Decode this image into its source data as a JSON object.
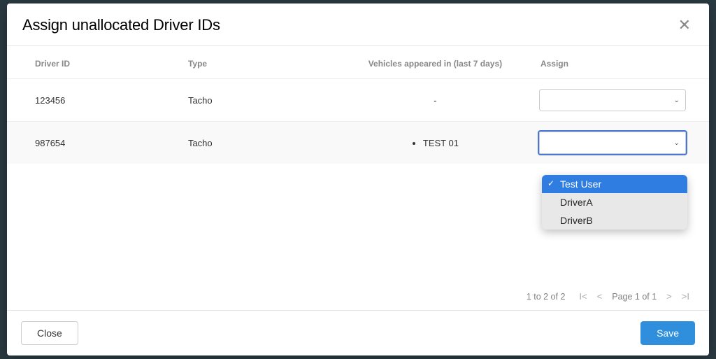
{
  "modal": {
    "title": "Assign unallocated Driver IDs"
  },
  "columns": {
    "driver_id": "Driver ID",
    "type": "Type",
    "vehicles": "Vehicles appeared in (last 7 days)",
    "assign": "Assign"
  },
  "rows": [
    {
      "driver_id": "123456",
      "type": "Tacho",
      "vehicles_dash": "-",
      "vehicles": []
    },
    {
      "driver_id": "987654",
      "type": "Tacho",
      "vehicles": [
        "TEST 01"
      ]
    }
  ],
  "dropdown": {
    "options": [
      "Test User",
      "DriverA",
      "DriverB"
    ],
    "selected": "Test User"
  },
  "pagination": {
    "range": "1 to 2 of 2",
    "page": "Page 1 of 1"
  },
  "footer": {
    "close": "Close",
    "save": "Save"
  }
}
